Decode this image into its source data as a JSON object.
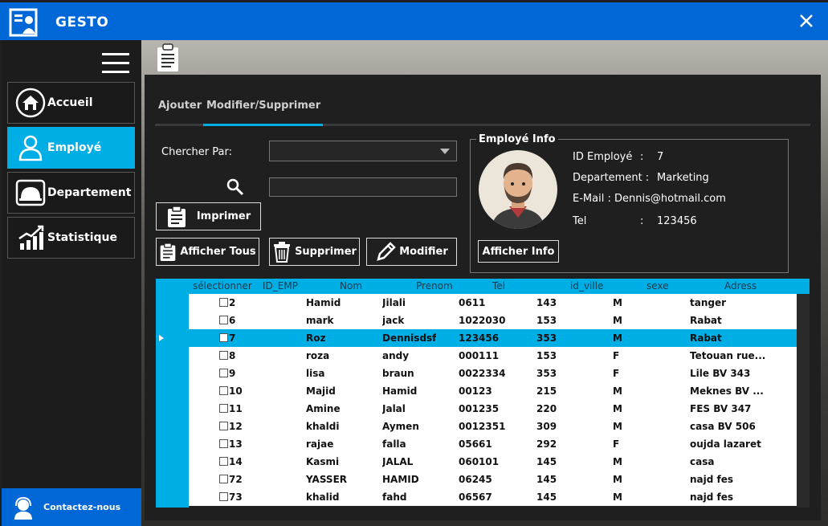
{
  "window": {
    "title": "GESTO"
  },
  "sidebar": {
    "items": [
      {
        "label": "Accueil",
        "icon": "home-icon"
      },
      {
        "label": "Employé",
        "icon": "user-icon"
      },
      {
        "label": "Departement",
        "icon": "helmet-icon"
      },
      {
        "label": "Statistique",
        "icon": "chart-icon"
      }
    ],
    "contact_label": "Contactez-nous"
  },
  "tabs": [
    {
      "label": "Ajouter"
    },
    {
      "label": "Modifier/Supprimer"
    }
  ],
  "form": {
    "search_by_label": "Chercher Par:",
    "search_by_value": "",
    "search_value": ""
  },
  "buttons": {
    "print": "Imprimer",
    "show_all": "Afficher Tous",
    "delete": "Supprimer",
    "modify": "Modifier",
    "show_info": "Afficher Info"
  },
  "employee_info": {
    "title": "Employé Info",
    "id_label": "ID Employé",
    "id_value": "7",
    "dept_label": "Departement :",
    "dept_value": "Marketing",
    "email_label": "E-Mail :",
    "email_value": "Dennis@hotmail.com",
    "tel_label": "Tel",
    "tel_value": "123456"
  },
  "grid": {
    "columns": [
      "sélectionner",
      "ID_EMP",
      "Nom",
      "Prenom",
      "Tel",
      "id_ville",
      "sexe",
      "Adress"
    ],
    "selected_index": 2,
    "rows": [
      [
        "2",
        "Hamid",
        "Jilali",
        "0611",
        "143",
        "M",
        "tanger"
      ],
      [
        "6",
        "mark",
        "jack",
        "1022030",
        "153",
        "M",
        "Rabat"
      ],
      [
        "7",
        "Roz",
        "Dennisdsf",
        "123456",
        "353",
        "M",
        "Rabat"
      ],
      [
        "8",
        "roza",
        "andy",
        "000111",
        "153",
        "F",
        "Tetouan rue..."
      ],
      [
        "9",
        "lisa",
        "braun",
        "0022334",
        "353",
        "F",
        "Lile BV 343"
      ],
      [
        "10",
        "Majid",
        "Hamid",
        "00123",
        "215",
        "M",
        "Meknes BV ..."
      ],
      [
        "11",
        "Amine",
        "Jalal",
        "001235",
        "220",
        "M",
        "FES BV 347"
      ],
      [
        "12",
        "khaldi",
        "Aymen",
        "0012351",
        "309",
        "M",
        "casa BV 506"
      ],
      [
        "13",
        "rajae",
        "falla",
        "05661",
        "292",
        "F",
        "oujda lazaret"
      ],
      [
        "14",
        "Kasmi",
        "JALAL",
        "060101",
        "145",
        "M",
        "casa"
      ],
      [
        "72",
        "YASSER",
        "HAMID",
        "06245",
        "145",
        "M",
        "najd fes"
      ],
      [
        "73",
        "khalid",
        "fahd",
        "06567",
        "145",
        "M",
        "najd fes"
      ]
    ]
  },
  "colors": {
    "accent": "#00aee6",
    "titlebar": "#0067d6",
    "panel": "#1f1f1f"
  }
}
